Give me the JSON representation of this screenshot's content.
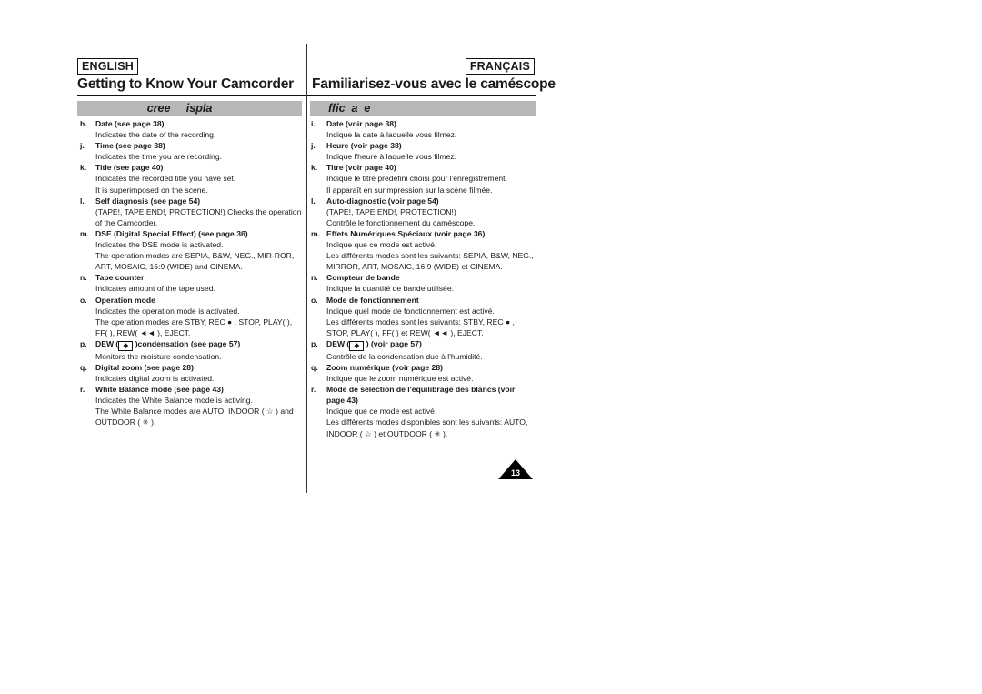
{
  "header": {
    "lang_en": "ENGLISH",
    "lang_fr": "FRANÇAIS",
    "title_en": "Getting to Know Your Camcorder",
    "title_fr": "Familiarisez-vous avec le caméscope",
    "band_en": "cree     ispla",
    "band_fr": "ffic  a  e"
  },
  "english": [
    {
      "letter": "h.",
      "head": "Date (see page 38)",
      "lines": [
        "Indicates the date of the recording."
      ]
    },
    {
      "letter": "j.",
      "head": "Time (see page 38)",
      "lines": [
        "Indicates the time you are recording."
      ]
    },
    {
      "letter": "k.",
      "head": "Title (see page 40)",
      "lines": [
        "Indicates the recorded title you have set.",
        "It is superimposed on the scene."
      ]
    },
    {
      "letter": "l.",
      "head": "Self diagnosis (see page 54)",
      "lines": [
        "(TAPE!, TAPE END!, PROTECTION!) Checks the operation of the Camcorder."
      ]
    },
    {
      "letter": "m.",
      "head": "DSE (Digital Special Effect) (see page 36)",
      "lines": [
        "Indicates the DSE mode is activated.",
        "The operation modes are SEPIA, B&W, NEG., MIR-ROR, ART, MOSAIC, 16:9 (WIDE) and CINEMA."
      ]
    },
    {
      "letter": "n.",
      "head": "Tape counter",
      "lines": [
        "Indicates amount of the tape used."
      ]
    },
    {
      "letter": "o.",
      "head": "Operation mode",
      "lines": [
        "Indicates the operation mode is activated.",
        "The operation modes are STBY, REC ● , STOP, PLAY(      ), FF(      ), REW( ◄◄ ), EJECT."
      ]
    },
    {
      "letter": "p.",
      "head_pre": "DEW (",
      "head_post": " )condensation (see page 57)",
      "dew": true,
      "lines": [
        "Monitors the moisture condensation."
      ]
    },
    {
      "letter": "q.",
      "head": "Digital zoom (see page 28)",
      "lines": [
        "Indicates digital zoom is activated."
      ]
    },
    {
      "letter": "r.",
      "head": "White Balance mode (see page 43)",
      "lines": [
        "Indicates the White Balance mode is activing.",
        "The White Balance modes are AUTO, INDOOR ( ☆ ) and OUTDOOR ( ✳ )."
      ]
    }
  ],
  "french": [
    {
      "letter": "i.",
      "head": "Date (voir page 38)",
      "lines": [
        "Indique la date à laquelle vous filmez."
      ]
    },
    {
      "letter": "j.",
      "head": "Heure (voir page 38)",
      "lines": [
        "Indique l'heure à laquelle vous filmez."
      ]
    },
    {
      "letter": "k.",
      "head": "Titre (voir page 40)",
      "lines": [
        "Indique le titre prédéfini choisi pour l'enregistrement.",
        "Il apparaît en surimpression sur la scène filmée."
      ]
    },
    {
      "letter": "l.",
      "head": "Auto-diagnostic (voir page 54)",
      "lines": [
        "(TAPE!, TAPE END!, PROTECTION!)",
        "Contrôle le fonctionnement du caméscope."
      ]
    },
    {
      "letter": "m.",
      "head": "Effets Numériques Spéciaux (voir page 36)",
      "lines": [
        "Indique que ce mode est activé.",
        "Les différents modes sont les suivants: SEPIA, B&W, NEG., MIRROR, ART, MOSAIC, 16:9 (WIDE) et CINEMA."
      ]
    },
    {
      "letter": "n.",
      "head": "Compteur de bande",
      "lines": [
        "Indique la quantité de bande utilisée."
      ]
    },
    {
      "letter": "o.",
      "head": "Mode de fonctionnement",
      "lines": [
        "Indique quel mode de fonctionnement est activé.",
        "Les différents modes sont les suivants: STBY, REC ● , STOP, PLAY(      ), FF(      ) et REW( ◄◄ ), EJECT."
      ]
    },
    {
      "letter": "p.",
      "head_pre": "DEW (",
      "head_post": " ) (voir page 57)",
      "dew": true,
      "lines": [
        "Contrôle de la condensation due à l'humidité."
      ]
    },
    {
      "letter": "q.",
      "head": "Zoom numérique (voir page 28)",
      "lines": [
        "Indique que le zoom numérique est activé."
      ]
    },
    {
      "letter": "r.",
      "head": "Mode de sélection de l'équilibrage des blancs (voir page 43)",
      "lines": [
        "Indique que ce mode est activé.",
        "Les différents modes disponibles sont les suivants: AUTO, INDOOR ( ☆ ) et OUTDOOR ( ✳ )."
      ]
    }
  ],
  "dew_icon": "droplet-icon",
  "dew_glyph": "◆",
  "page_number": "13"
}
